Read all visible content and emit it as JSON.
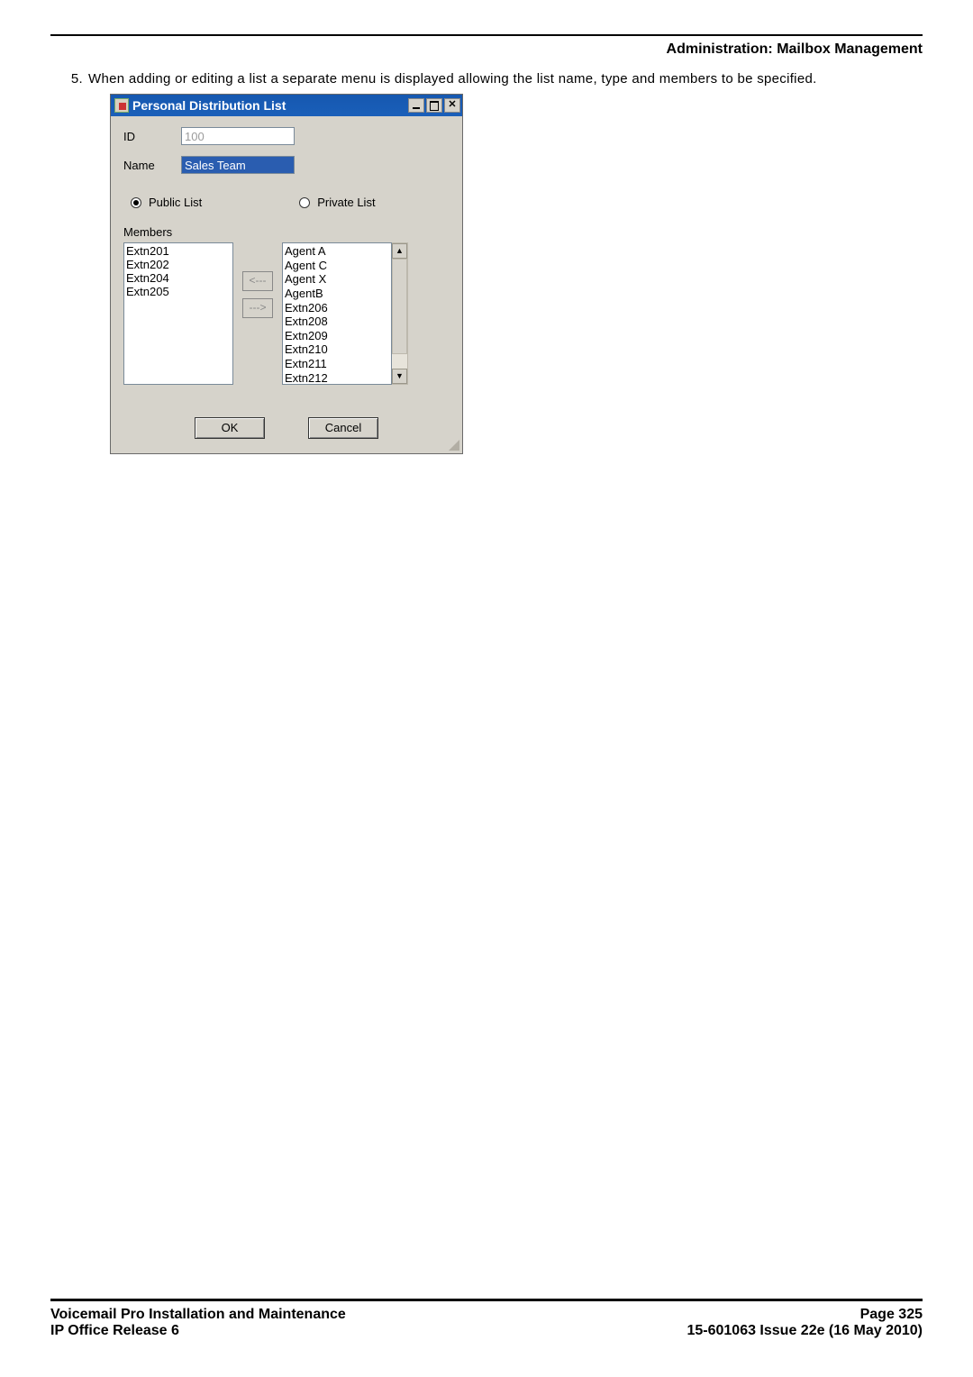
{
  "header": {
    "section": "Administration: Mailbox Management"
  },
  "step": {
    "number": "5.",
    "text": "When adding or editing a list a separate menu is displayed allowing the list name, type and members to be specified."
  },
  "dialog": {
    "title": "Personal Distribution List",
    "win": {
      "min": "",
      "max": "",
      "close": "✕"
    },
    "fields": {
      "id_label": "ID",
      "id_value": "100",
      "name_label": "Name",
      "name_value": "Sales Team"
    },
    "radios": {
      "public": "Public List",
      "private": "Private List",
      "selected": "public"
    },
    "members_label": "Members",
    "left_list": [
      "Extn201",
      "Extn202",
      "Extn204",
      "Extn205"
    ],
    "right_list": [
      "Agent A",
      "Agent C",
      "Agent X",
      "AgentB",
      "Extn206",
      "Extn208",
      "Extn209",
      "Extn210",
      "Extn211",
      "Extn212"
    ],
    "move": {
      "left": "<---",
      "right": "--->"
    },
    "scroll": {
      "up": "▲",
      "down": "▼"
    },
    "buttons": {
      "ok": "OK",
      "cancel": "Cancel"
    }
  },
  "footer": {
    "left1": "Voicemail Pro Installation and Maintenance",
    "left2": "IP Office Release 6",
    "right1": "Page 325",
    "right2": "15-601063 Issue 22e (16 May 2010)"
  }
}
